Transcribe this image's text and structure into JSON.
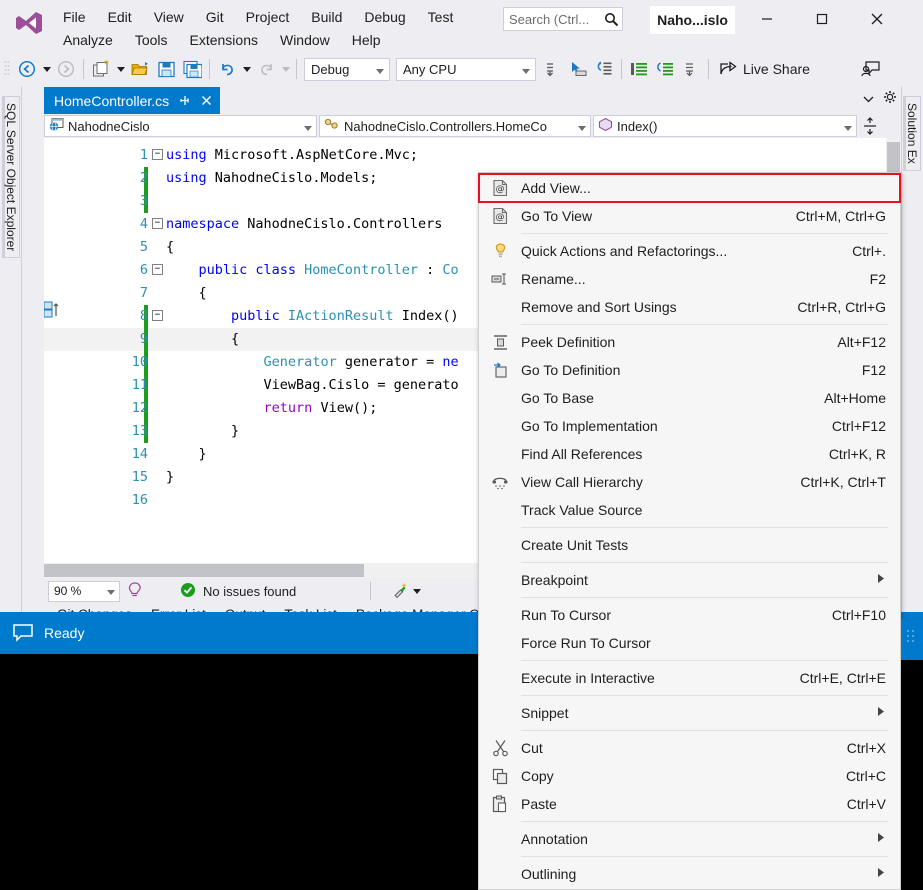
{
  "app": {
    "title": "Naho...islo",
    "logo": "visual-studio-logo"
  },
  "menubar": {
    "row1": [
      "File",
      "Edit",
      "View",
      "Git",
      "Project",
      "Build",
      "Debug",
      "Test"
    ],
    "row2": [
      "Analyze",
      "Tools",
      "Extensions",
      "Window",
      "Help"
    ]
  },
  "search": {
    "placeholder": "Search (Ctrl...",
    "icon": "search-icon"
  },
  "window_controls": {
    "minimize": "minimize-icon",
    "maximize": "maximize-icon",
    "close": "close-icon"
  },
  "toolbar": {
    "navigate_back": "navigate-back-icon",
    "navigate_forward": "navigate-forward-icon",
    "new_item": "new-item-icon",
    "open_file": "open-file-icon",
    "save": "save-icon",
    "save_all": "save-all-icon",
    "undo": "undo-icon",
    "redo": "redo-icon",
    "configuration": "Debug",
    "platform": "Any CPU",
    "live_share_label": "Live Share",
    "live_share_icon": "share-icon",
    "account_icon": "account-icon",
    "step_icon": "step-into-icon",
    "pointer_icon": "select-element-icon",
    "hot_reload_icon": "hot-reload-icon",
    "indent_icon": "indent-icon",
    "outdent_icon": "outdent-icon"
  },
  "rails": {
    "left_label": "SQL Server Object Explorer",
    "right_label": "Solution Ex"
  },
  "document_tab": {
    "label": "HomeController.cs",
    "pin_icon": "pin-icon",
    "close_icon": "close-icon",
    "overflow_icon": "chevron-down-icon",
    "settings_icon": "gear-icon"
  },
  "navbar": {
    "project": "NahodneCislo",
    "project_icon": "project-icon",
    "type": "NahodneCislo.Controllers.HomeCo",
    "type_icon": "class-icon",
    "member": "Index()",
    "member_icon": "method-icon",
    "split_icon": "split-view-icon"
  },
  "code": {
    "lines": [
      {
        "num": "1",
        "fold": "minus",
        "change": false,
        "current": false,
        "tokens": [
          {
            "t": "using ",
            "c": "kw"
          },
          {
            "t": "Microsoft.AspNetCore.Mvc;",
            "c": "pln"
          }
        ]
      },
      {
        "num": "2",
        "fold": "",
        "change": true,
        "current": false,
        "tokens": [
          {
            "t": "using ",
            "c": "kw"
          },
          {
            "t": "NahodneCislo.Models;",
            "c": "pln"
          }
        ]
      },
      {
        "num": "3",
        "fold": "",
        "change": true,
        "current": false,
        "tokens": []
      },
      {
        "num": "4",
        "fold": "minus",
        "change": false,
        "current": false,
        "tokens": [
          {
            "t": "namespace ",
            "c": "kw"
          },
          {
            "t": "NahodneCislo.Controllers",
            "c": "pln"
          }
        ]
      },
      {
        "num": "5",
        "fold": "",
        "change": false,
        "current": false,
        "tokens": [
          {
            "t": "{",
            "c": "pln"
          }
        ]
      },
      {
        "num": "6",
        "fold": "minus",
        "change": false,
        "current": false,
        "tokens": [
          {
            "t": "    public class ",
            "c": "kw"
          },
          {
            "t": "HomeController",
            "c": "cls"
          },
          {
            "t": " : ",
            "c": "pln"
          },
          {
            "t": "Co",
            "c": "cls"
          }
        ]
      },
      {
        "num": "7",
        "fold": "",
        "change": false,
        "current": false,
        "tokens": [
          {
            "t": "    {",
            "c": "pln"
          }
        ]
      },
      {
        "num": "8",
        "fold": "minus",
        "change": true,
        "current": false,
        "tokens": [
          {
            "t": "        public ",
            "c": "kw"
          },
          {
            "t": "IActionResult",
            "c": "cls"
          },
          {
            "t": " ",
            "c": "pln"
          },
          {
            "t": "Index()",
            "c": "pln"
          }
        ]
      },
      {
        "num": "9",
        "fold": "",
        "change": true,
        "current": true,
        "tokens": [
          {
            "t": "        {",
            "c": "pln"
          }
        ]
      },
      {
        "num": "10",
        "fold": "",
        "change": true,
        "current": false,
        "tokens": [
          {
            "t": "            ",
            "c": "pln"
          },
          {
            "t": "Generator",
            "c": "cls"
          },
          {
            "t": " generator = ",
            "c": "pln"
          },
          {
            "t": "ne",
            "c": "kw"
          }
        ]
      },
      {
        "num": "11",
        "fold": "",
        "change": true,
        "current": false,
        "tokens": [
          {
            "t": "            ViewBag.Cislo = generato",
            "c": "pln"
          }
        ]
      },
      {
        "num": "12",
        "fold": "",
        "change": true,
        "current": false,
        "tokens": [
          {
            "t": "            ",
            "c": "pln"
          },
          {
            "t": "return ",
            "c": "ctrl"
          },
          {
            "t": "View();",
            "c": "pln"
          }
        ]
      },
      {
        "num": "13",
        "fold": "",
        "change": true,
        "current": false,
        "tokens": [
          {
            "t": "        }",
            "c": "pln"
          }
        ]
      },
      {
        "num": "14",
        "fold": "",
        "change": false,
        "current": false,
        "tokens": [
          {
            "t": "    }",
            "c": "pln"
          }
        ]
      },
      {
        "num": "15",
        "fold": "",
        "change": false,
        "current": false,
        "tokens": [
          {
            "t": "}",
            "c": "pln"
          }
        ]
      },
      {
        "num": "16",
        "fold": "",
        "change": false,
        "current": false,
        "tokens": []
      }
    ]
  },
  "editor_status": {
    "zoom": "90 %",
    "intellicode_icon": "intellicode-icon",
    "issues_text": "No issues found",
    "issues_icon": "check-circle-icon",
    "cleanup_icon": "code-cleanup-icon"
  },
  "bottom_tabs": [
    "Git Changes",
    "Error List",
    "Output",
    "Task List",
    "Package Manager Cor"
  ],
  "statusbar": {
    "icon": "notification-icon",
    "text": "Ready",
    "right_icon": "source-control-up-icon"
  },
  "context_menu": {
    "items": [
      {
        "label": "Add View...",
        "shortcut": "",
        "icon": "view-page-icon",
        "submenu": false,
        "highlight": true,
        "sep_after": false
      },
      {
        "label": "Go To View",
        "shortcut": "Ctrl+M, Ctrl+G",
        "icon": "view-page-icon",
        "submenu": false,
        "highlight": false,
        "sep_after": true
      },
      {
        "label": "Quick Actions and Refactorings...",
        "shortcut": "Ctrl+.",
        "icon": "lightbulb-icon",
        "submenu": false,
        "highlight": false,
        "sep_after": false
      },
      {
        "label": "Rename...",
        "shortcut": "F2",
        "icon": "rename-icon",
        "submenu": false,
        "highlight": false,
        "sep_after": false
      },
      {
        "label": "Remove and Sort Usings",
        "shortcut": "Ctrl+R, Ctrl+G",
        "icon": "",
        "submenu": false,
        "highlight": false,
        "sep_after": true
      },
      {
        "label": "Peek Definition",
        "shortcut": "Alt+F12",
        "icon": "peek-definition-icon",
        "submenu": false,
        "highlight": false,
        "sep_after": false
      },
      {
        "label": "Go To Definition",
        "shortcut": "F12",
        "icon": "go-to-definition-icon",
        "submenu": false,
        "highlight": false,
        "sep_after": false
      },
      {
        "label": "Go To Base",
        "shortcut": "Alt+Home",
        "icon": "",
        "submenu": false,
        "highlight": false,
        "sep_after": false
      },
      {
        "label": "Go To Implementation",
        "shortcut": "Ctrl+F12",
        "icon": "",
        "submenu": false,
        "highlight": false,
        "sep_after": false
      },
      {
        "label": "Find All References",
        "shortcut": "Ctrl+K, R",
        "icon": "",
        "submenu": false,
        "highlight": false,
        "sep_after": false
      },
      {
        "label": "View Call Hierarchy",
        "shortcut": "Ctrl+K, Ctrl+T",
        "icon": "call-hierarchy-icon",
        "submenu": false,
        "highlight": false,
        "sep_after": false
      },
      {
        "label": "Track Value Source",
        "shortcut": "",
        "icon": "",
        "submenu": false,
        "highlight": false,
        "sep_after": true
      },
      {
        "label": "Create Unit Tests",
        "shortcut": "",
        "icon": "",
        "submenu": false,
        "highlight": false,
        "sep_after": true
      },
      {
        "label": "Breakpoint",
        "shortcut": "",
        "icon": "",
        "submenu": true,
        "highlight": false,
        "sep_after": true
      },
      {
        "label": "Run To Cursor",
        "shortcut": "Ctrl+F10",
        "icon": "",
        "submenu": false,
        "highlight": false,
        "sep_after": false
      },
      {
        "label": "Force Run To Cursor",
        "shortcut": "",
        "icon": "",
        "submenu": false,
        "highlight": false,
        "sep_after": true
      },
      {
        "label": "Execute in Interactive",
        "shortcut": "Ctrl+E, Ctrl+E",
        "icon": "",
        "submenu": false,
        "highlight": false,
        "sep_after": true
      },
      {
        "label": "Snippet",
        "shortcut": "",
        "icon": "",
        "submenu": true,
        "highlight": false,
        "sep_after": true
      },
      {
        "label": "Cut",
        "shortcut": "Ctrl+X",
        "icon": "cut-icon",
        "submenu": false,
        "highlight": false,
        "sep_after": false
      },
      {
        "label": "Copy",
        "shortcut": "Ctrl+C",
        "icon": "copy-icon",
        "submenu": false,
        "highlight": false,
        "sep_after": false
      },
      {
        "label": "Paste",
        "shortcut": "Ctrl+V",
        "icon": "paste-icon",
        "submenu": false,
        "highlight": false,
        "sep_after": true
      },
      {
        "label": "Annotation",
        "shortcut": "",
        "icon": "",
        "submenu": true,
        "highlight": false,
        "sep_after": true
      },
      {
        "label": "Outlining",
        "shortcut": "",
        "icon": "",
        "submenu": true,
        "highlight": false,
        "sep_after": false
      }
    ]
  },
  "colors": {
    "accent": "#007acc",
    "chrome": "#eeeef2",
    "highlight_border": "#e81123",
    "keyword": "#0000ff",
    "type": "#2b91af",
    "control": "#8f08c4",
    "change_bar": "#1e9c1e"
  }
}
